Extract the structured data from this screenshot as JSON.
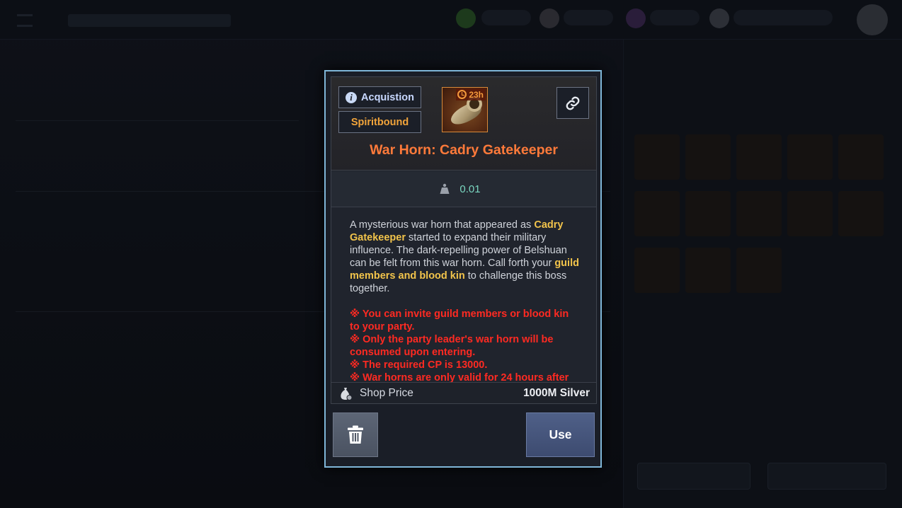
{
  "item": {
    "acquisition_label": "Acquistion",
    "binding_label": "Spiritbound",
    "timer": "23h",
    "name": "War Horn: Cadry Gatekeeper",
    "weight": "0.01",
    "description": {
      "p1_a": "A mysterious war horn that appeared as ",
      "p1_hl1": "Cadry Gatekeeper",
      "p1_b": " started to expand their military influence. The dark-repelling power of Belshuan can be felt from this war horn. Call forth your ",
      "p1_hl2": "guild members and blood kin",
      "p1_c": " to challenge this boss together.",
      "notes": [
        "※ You can invite guild members or blood kin to your party.",
        "※ Only the party leader's war horn will be consumed upon entering.",
        "※ The required CP is 13000.",
        "※ War horns are only valid for 24 hours after"
      ]
    },
    "price_label": "Shop Price",
    "price_value": "1000M Silver"
  },
  "actions": {
    "use_label": "Use"
  },
  "colors": {
    "item_name": "#ff7a3a",
    "highlight": "#f2c44b",
    "warning": "#ff2a22",
    "modal_border": "#7fb6d8"
  },
  "icons": [
    "info-icon",
    "clock-icon",
    "link-icon",
    "weight-icon",
    "money-bag-icon",
    "trash-icon"
  ]
}
